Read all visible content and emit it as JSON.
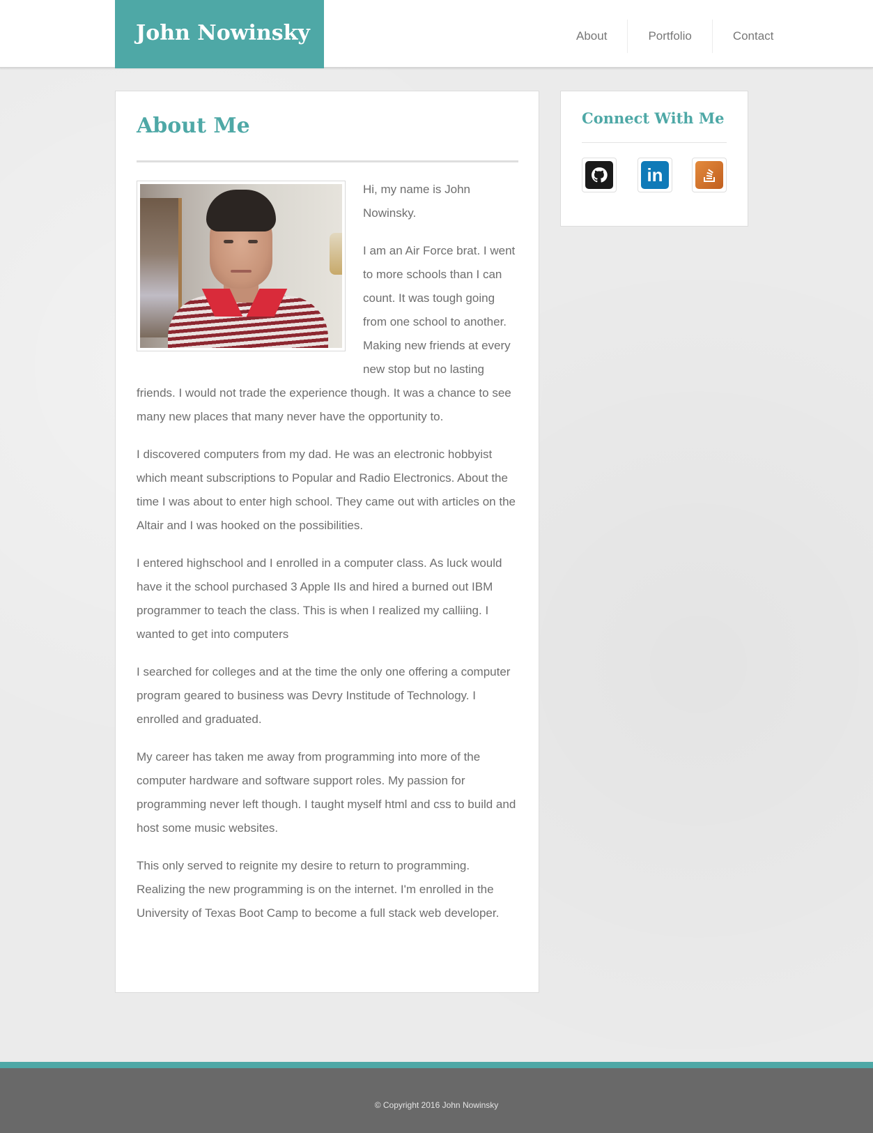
{
  "header": {
    "brand": "John Nowinsky",
    "nav": [
      "About",
      "Portfolio",
      "Contact"
    ]
  },
  "about": {
    "title": "About Me",
    "photo_alt": "Photo of John Nowinsky",
    "paragraphs": [
      "Hi, my name is John Nowinsky.",
      "I am an Air Force brat. I went to more schools than I can count. It was tough going from one school to another. Making new friends at every new stop but no lasting friends. I would not trade the experience though. It was a chance to see many new places that many never have the opportunity to.",
      "I discovered computers from my dad. He was an electronic hobbyist which meant subscriptions to Popular and Radio Electronics. About the time I was about to enter high school. They came out with articles on the Altair and I was hooked on the possibilities.",
      "I entered highschool and I enrolled in a computer class. As luck would have it the school purchased 3 Apple IIs and hired a burned out IBM programmer to teach the class. This is when I realized my calliing. I wanted to get into computers",
      "I searched for colleges and at the time the only one offering a computer program geared to business was Devry Institude of Technology. I enrolled and graduated.",
      "My career has taken me away from programming into more of the computer hardware and software support roles. My passion for programming never left though. I taught myself html and css to build and host some music websites.",
      "This only served to reignite my desire to return to programming. Realizing the new programming is on the internet. I'm enrolled in the University of Texas Boot Camp to become a full stack web developer."
    ]
  },
  "sidebar": {
    "title": "Connect With Me",
    "links": [
      {
        "icon": "github-icon",
        "color": "#1a1a1a"
      },
      {
        "icon": "linkedin-icon",
        "color": "#0f7ab8",
        "glyph": "in"
      },
      {
        "icon": "stackoverflow-icon",
        "color": "#d47330"
      }
    ]
  },
  "footer": {
    "copyright": "© Copyright 2016 John Nowinsky"
  },
  "colors": {
    "accent": "#4ea8a6",
    "footer_bg": "#696969",
    "text": "#6e6e6e"
  }
}
